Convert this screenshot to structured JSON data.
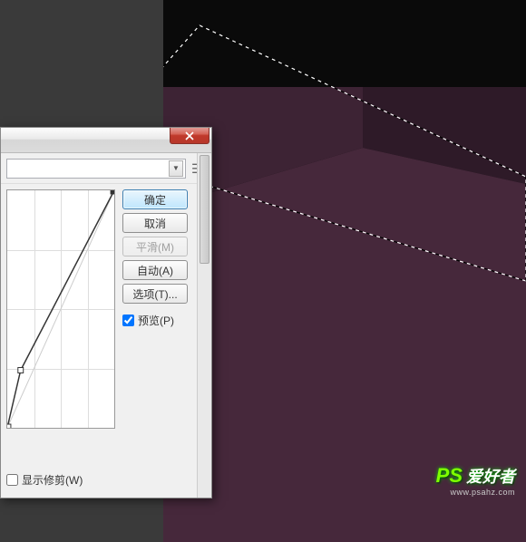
{
  "canvas": {
    "colors": {
      "bg": "#0a0a0a",
      "face1": "#3d2334",
      "face2": "#2e1a28",
      "face3": "#46283b"
    }
  },
  "dialog": {
    "buttons": {
      "ok": "确定",
      "cancel": "取消",
      "smooth": "平滑(M)",
      "auto": "自动(A)",
      "options": "选项(T)..."
    },
    "preview": "预览(P)",
    "preview_checked": true,
    "show_clip": "显示修剪(W)",
    "show_clip_checked": false
  },
  "watermark": {
    "prefix": "PS",
    "text": "爱好者",
    "url": "www.psahz.com"
  }
}
